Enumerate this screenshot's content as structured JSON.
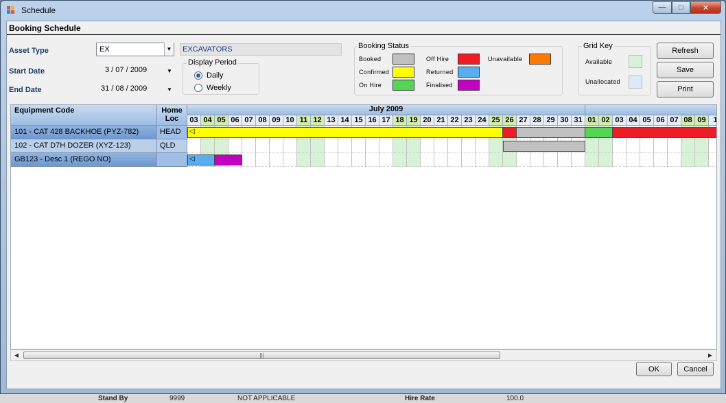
{
  "window": {
    "title": "Schedule"
  },
  "form": {
    "heading": "Booking Schedule",
    "asset_type_label": "Asset Type",
    "asset_type_value": "EX",
    "asset_type_desc": "EXCAVATORS",
    "start_date_label": "Start Date",
    "start_date_value": "3 / 07 / 2009",
    "end_date_label": "End Date",
    "end_date_value": "31 / 08 / 2009"
  },
  "display_period": {
    "title": "Display Period",
    "daily_label": "Daily",
    "weekly_label": "Weekly",
    "selected": "daily"
  },
  "booking_status": {
    "title": "Booking Status",
    "items": [
      {
        "key": "booked",
        "label": "Booked",
        "color": "#c0c0c0"
      },
      {
        "key": "confirmed",
        "label": "Confirmed",
        "color": "#ffff00"
      },
      {
        "key": "on_hire",
        "label": "On Hire",
        "color": "#55d455"
      },
      {
        "key": "off_hire",
        "label": "Off Hire",
        "color": "#ee1c24"
      },
      {
        "key": "returned",
        "label": "Returned",
        "color": "#58aef0"
      },
      {
        "key": "finalised",
        "label": "Finalised",
        "color": "#c400c4"
      },
      {
        "key": "unavailable",
        "label": "Unavailable",
        "color": "#ff7a00"
      }
    ]
  },
  "grid_key": {
    "title": "Grid Key",
    "available_label": "Available",
    "available_color": "#d8f2d8",
    "unallocated_label": "Unallocated",
    "unallocated_color": "#dceaf8"
  },
  "buttons": {
    "refresh": "Refresh",
    "save": "Save",
    "print": "Print",
    "ok": "OK",
    "cancel": "Cancel"
  },
  "schedule": {
    "col_equipment": "Equipment Code",
    "col_home_loc": "Home\nLoc",
    "months": [
      {
        "label": "July 2009",
        "start_index": 0,
        "count": 29
      },
      {
        "label": "",
        "start_index": 29,
        "count": 10
      }
    ],
    "days": [
      "03",
      "04",
      "05",
      "06",
      "07",
      "08",
      "09",
      "10",
      "11",
      "12",
      "13",
      "14",
      "15",
      "16",
      "17",
      "18",
      "19",
      "20",
      "21",
      "22",
      "23",
      "24",
      "25",
      "26",
      "27",
      "28",
      "29",
      "30",
      "31",
      "01",
      "02",
      "03",
      "04",
      "05",
      "06",
      "07",
      "08",
      "09",
      "1"
    ],
    "weekend_indices": [
      1,
      2,
      8,
      9,
      15,
      16,
      22,
      23,
      29,
      30,
      36,
      37
    ],
    "rows": [
      {
        "code": "101 - CAT 428 BACKHOE (PYZ-782)",
        "home_loc": "HEAD",
        "selected": true,
        "start_marker": true,
        "bars": [
          {
            "status": "confirmed",
            "from": 0,
            "to": 22
          },
          {
            "status": "off_hire",
            "from": 23,
            "to": 23
          },
          {
            "status": "booked",
            "from": 24,
            "to": 28
          },
          {
            "status": "on_hire",
            "from": 29,
            "to": 30
          },
          {
            "status": "off_hire",
            "from": 31,
            "to": 38
          }
        ]
      },
      {
        "code": "102 - CAT D7H DOZER (XYZ-123)",
        "home_loc": "QLD",
        "selected": false,
        "start_marker": false,
        "bars": [
          {
            "status": "booked",
            "from": 23,
            "to": 28
          }
        ]
      },
      {
        "code": "GB123 - Desc 1 (REGO NO)",
        "home_loc": "",
        "selected": true,
        "start_marker": true,
        "bars": [
          {
            "status": "returned",
            "from": 0,
            "to": 1
          },
          {
            "status": "finalised",
            "from": 2,
            "to": 3
          }
        ]
      }
    ]
  },
  "background_app": {
    "stand_by_label": "Stand By",
    "stand_by_value": "9999",
    "na_value": "NOT APPLICABLE",
    "hire_rate_label": "Hire Rate",
    "hire_rate_value": "100.0"
  }
}
